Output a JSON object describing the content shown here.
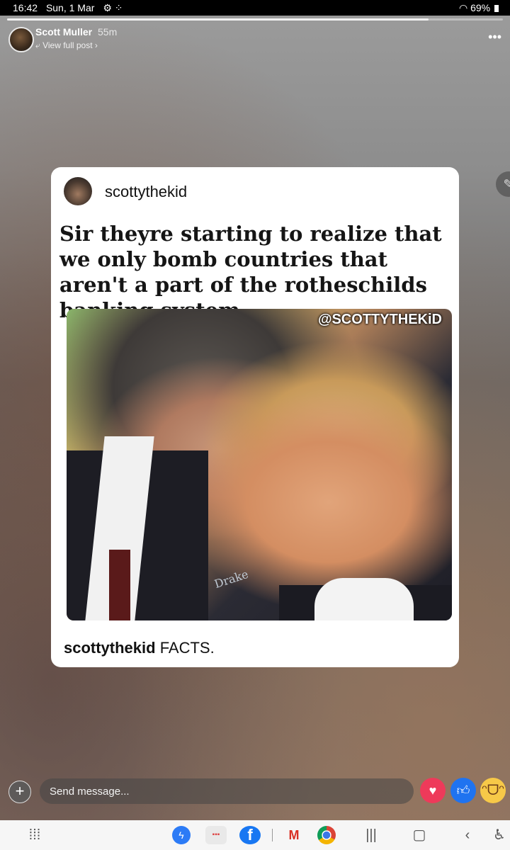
{
  "status_bar": {
    "time": "16:42",
    "date": "Sun, 1 Mar",
    "battery": "69%"
  },
  "story": {
    "progress": 0.85,
    "author_name": "Scott Muller",
    "time_ago": "55m",
    "view_full_post": "View full post",
    "more_icon": "more-horizontal-icon",
    "edit_icon": "pencil-icon"
  },
  "post": {
    "username": "scottythekid",
    "meme_headline": "Sir theyre starting to realize that we only bomb countries that aren't a part of the rotheschilds banking system.",
    "watermark": "@SCOTTYTHEKiD",
    "photo_sign_text": "Drake",
    "caption_user": "scottythekid",
    "caption_text": " FACTS."
  },
  "message_bar": {
    "placeholder": "Send message...",
    "add_icon": "plus-circle-icon",
    "reactions": [
      "love",
      "like",
      "haha"
    ]
  },
  "nav_bar": {
    "icons": [
      "apps-grid-icon",
      "messenger-icon",
      "folder-icon",
      "facebook-icon",
      "gmail-icon",
      "chrome-icon",
      "recent-apps-icon",
      "home-icon",
      "back-icon",
      "accessibility-icon"
    ]
  },
  "colors": {
    "love": "#ee3a5a",
    "like": "#1f73f0",
    "haha": "#f7c948",
    "facebook": "#1877f2"
  }
}
